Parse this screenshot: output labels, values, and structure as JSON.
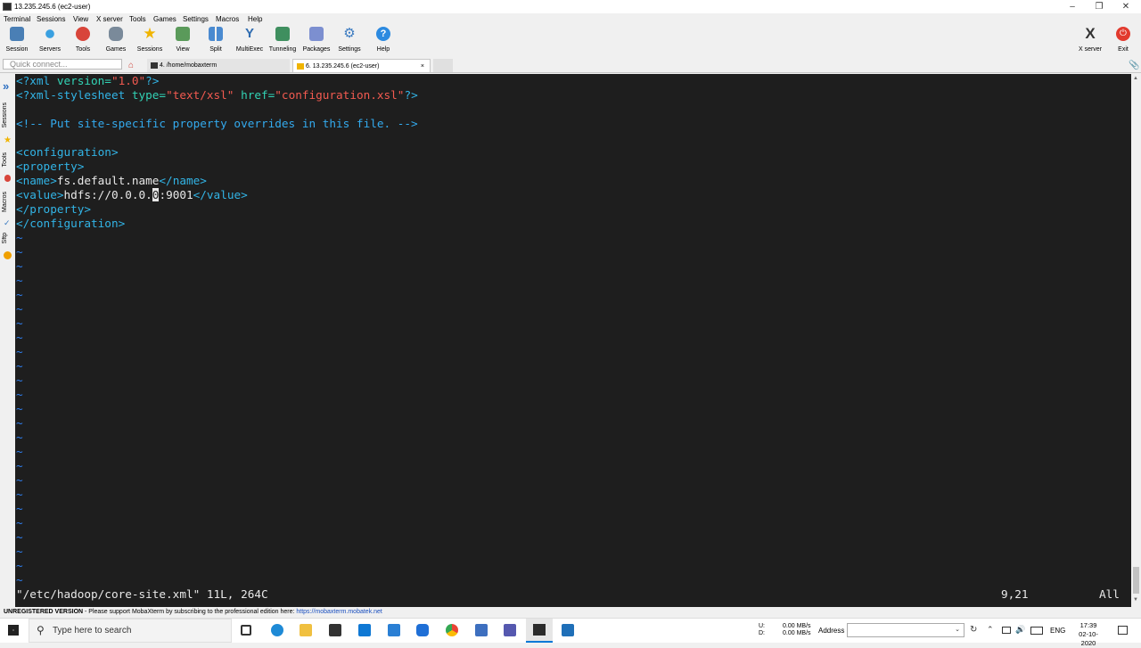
{
  "window": {
    "title": "13.235.245.6 (ec2-user)"
  },
  "menu": [
    "Terminal",
    "Sessions",
    "View",
    "X server",
    "Tools",
    "Games",
    "Settings",
    "Macros",
    "Help"
  ],
  "toolbar": {
    "buttons": [
      "Session",
      "Servers",
      "Tools",
      "Games",
      "Sessions",
      "View",
      "Split",
      "MultiExec",
      "Tunneling",
      "Packages",
      "Settings",
      "Help"
    ],
    "xserver_label": "X server",
    "exit_label": "Exit"
  },
  "tabs": {
    "quick_connect_placeholder": "Quick connect...",
    "tab1": "4. /home/mobaxterm",
    "tab2": "6. 13.235.245.6 (ec2-user)",
    "close_glyph": "×"
  },
  "side": {
    "sessions": "Sessions",
    "tools": "Tools",
    "macros": "Macros",
    "sftp": "Sftp"
  },
  "editor": {
    "line1": {
      "open": "<?xml",
      "attr": " version=",
      "val": "\"1.0\"",
      "close": "?>"
    },
    "line2": {
      "open": "<?xml-stylesheet",
      "attr1": " type=",
      "val1": "\"text/xsl\"",
      "attr2": " href=",
      "val2": "\"configuration.xsl\"",
      "close": "?>"
    },
    "comment": "<!-- Put site-specific property overrides in this file. -->",
    "configuration_open": "<configuration>",
    "property_open": "<property>",
    "name_open": "<name>",
    "name_text": "fs.default.name",
    "name_close": "</name>",
    "value_open": "<value>",
    "value_text_before": "hdfs://0.0.0.",
    "value_cursor_char": "0",
    "value_text_after": ":9001",
    "value_close": "</value>",
    "property_close": "</property>",
    "configuration_close": "</configuration>",
    "tilde": "~",
    "status_file": "\"/etc/hadoop/core-site.xml\" 11L, 264C",
    "status_pos": "9,21",
    "status_all": "All"
  },
  "statusbar": {
    "unregistered": "UNREGISTERED VERSION",
    "message": "  -  Please support MobaXterm by subscribing to the professional edition here: ",
    "link": "https://mobaxterm.mobatek.net"
  },
  "taskbar": {
    "search_placeholder": "Type here to search",
    "net_u_label": "U:",
    "net_d_label": "D:",
    "net_u_value": "0.00 MB/s",
    "net_d_value": "0.00 MB/s",
    "address_label": "Address",
    "lang": "ENG",
    "time": "17:39",
    "date": "02-10-2020"
  },
  "colors": {
    "terminal_bg": "#1e1e1e",
    "tag": "#32b4e6",
    "attr": "#32d3b5",
    "value": "#f25a50",
    "tilde": "#2f7ff0"
  }
}
